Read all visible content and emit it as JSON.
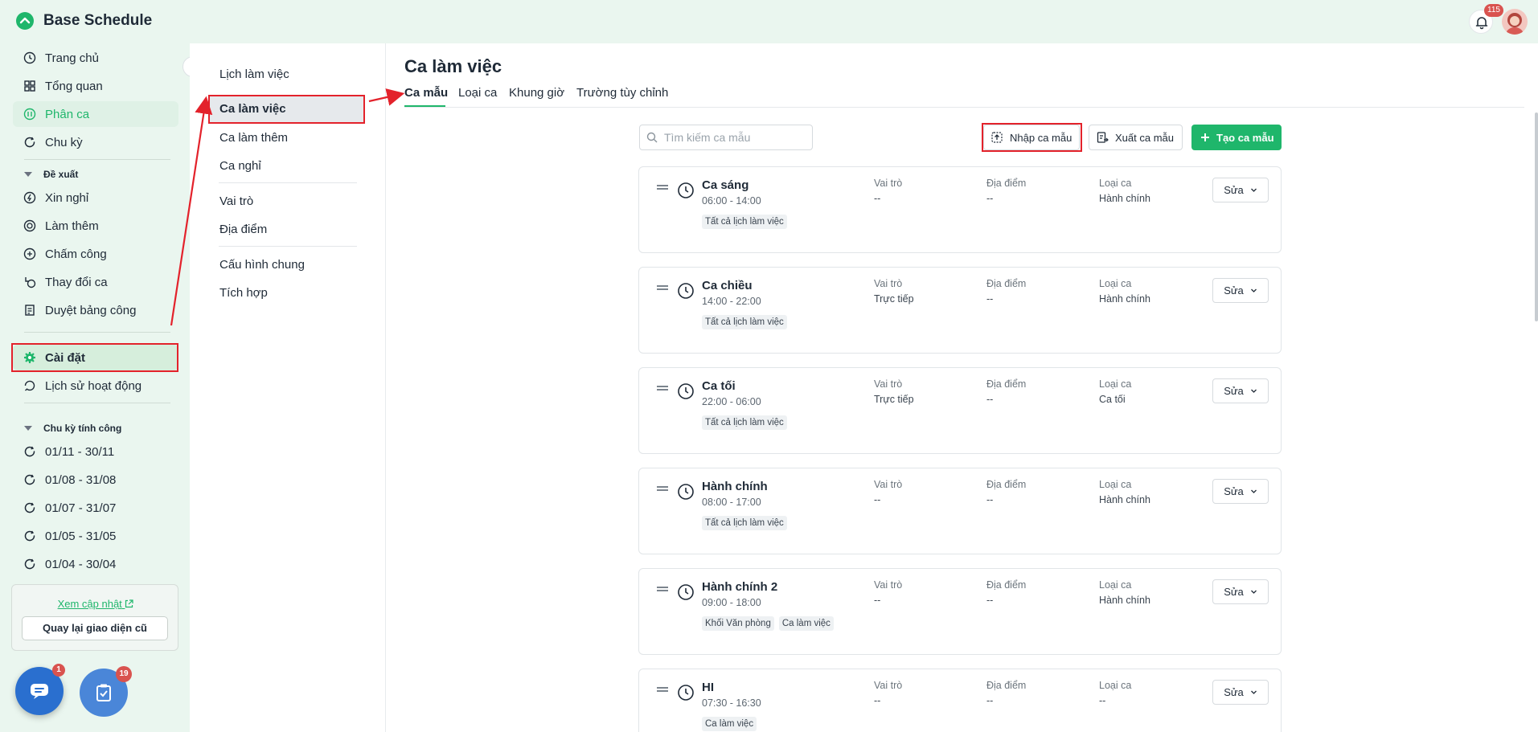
{
  "app": {
    "title": "Base Schedule",
    "notification_count": "115"
  },
  "sidebar": {
    "items": [
      {
        "label": "Trang chủ",
        "icon": "clock-icon"
      },
      {
        "label": "Tổng quan",
        "icon": "grid-icon"
      },
      {
        "label": "Phân ca",
        "icon": "shift-icon"
      },
      {
        "label": "Chu kỳ",
        "icon": "cycle-icon"
      }
    ],
    "proposal_group": "Đề xuất",
    "proposal_items": [
      {
        "label": "Xin nghỉ",
        "icon": "leave-icon"
      },
      {
        "label": "Làm thêm",
        "icon": "overtime-icon"
      },
      {
        "label": "Chấm công",
        "icon": "timesheet-icon"
      },
      {
        "label": "Thay đổi ca",
        "icon": "swap-icon"
      },
      {
        "label": "Duyệt bảng công",
        "icon": "approve-icon"
      }
    ],
    "settings": "Cài đặt",
    "history": "Lịch sử hoạt động",
    "cycle_group": "Chu kỳ tính công",
    "cycles": [
      "01/11 - 30/11",
      "01/08 - 31/08",
      "01/07 - 31/07",
      "01/05 - 31/05",
      "01/04 - 30/04"
    ],
    "update_link": "Xem cập nhật",
    "old_ui_button": "Quay lại giao diện cũ",
    "chat_badge": "1",
    "task_badge": "19"
  },
  "submenu": {
    "items": [
      "Lịch làm việc",
      "Ca làm việc",
      "Ca làm thêm",
      "Ca nghỉ",
      "Vai trò",
      "Địa điểm",
      "Cấu hình chung",
      "Tích hợp"
    ]
  },
  "main": {
    "title": "Ca làm việc",
    "tabs": [
      "Ca mẫu",
      "Loại ca",
      "Khung giờ",
      "Trường tùy chỉnh"
    ],
    "search_placeholder": "Tìm kiếm ca mẫu",
    "import_button": "Nhập ca mẫu",
    "export_button": "Xuất ca mẫu",
    "create_button": "Tạo ca mẫu",
    "labels": {
      "role": "Vai trò",
      "location": "Địa điểm",
      "type": "Loại ca",
      "edit": "Sửa"
    },
    "shifts": [
      {
        "name": "Ca sáng",
        "time": "06:00 - 14:00",
        "role": "--",
        "location": "--",
        "type": "Hành chính",
        "tags": [
          "Tất cả lịch làm việc"
        ]
      },
      {
        "name": "Ca chiều",
        "time": "14:00 - 22:00",
        "role": "Trực tiếp",
        "location": "--",
        "type": "Hành chính",
        "tags": [
          "Tất cả lịch làm việc"
        ]
      },
      {
        "name": "Ca tối",
        "time": "22:00 - 06:00",
        "role": "Trực tiếp",
        "location": "--",
        "type": "Ca tối",
        "tags": [
          "Tất cả lịch làm việc"
        ]
      },
      {
        "name": "Hành chính",
        "time": "08:00 - 17:00",
        "role": "--",
        "location": "--",
        "type": "Hành chính",
        "tags": [
          "Tất cả lịch làm việc"
        ]
      },
      {
        "name": "Hành chính 2",
        "time": "09:00 - 18:00",
        "role": "--",
        "location": "--",
        "type": "Hành chính",
        "tags": [
          "Khối Văn phòng",
          "Ca làm việc"
        ]
      },
      {
        "name": "HI",
        "time": "07:30 - 16:30",
        "role": "--",
        "location": "--",
        "type": "--",
        "tags": [
          "Ca làm việc"
        ]
      }
    ]
  },
  "colors": {
    "accent": "#1fb66b",
    "annotation": "#e3222b",
    "sidebar_bg": "#eaf6ef"
  }
}
